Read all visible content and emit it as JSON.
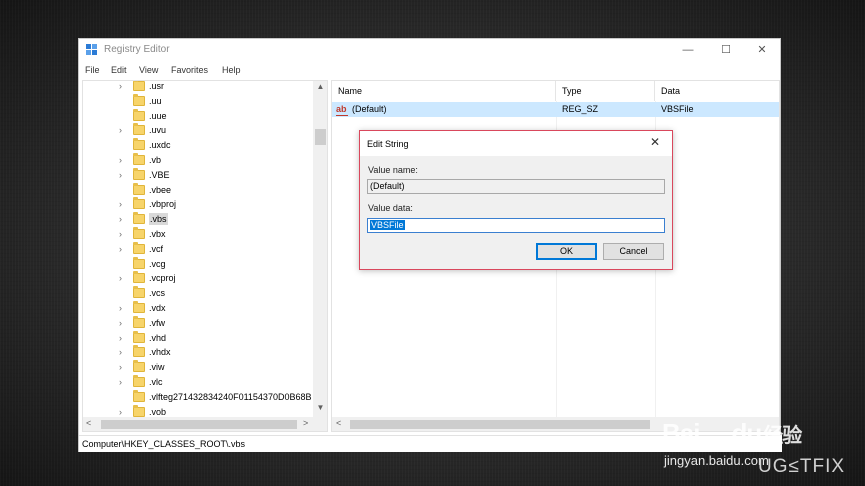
{
  "window": {
    "title": "Registry Editor",
    "controls": {
      "minimize": "—",
      "maximize": "☐",
      "close": "✕"
    }
  },
  "menu": [
    "File",
    "Edit",
    "View",
    "Favorites",
    "Help"
  ],
  "tree": {
    "items": [
      {
        "label": ".usr",
        "expandable": true
      },
      {
        "label": ".uu",
        "expandable": false
      },
      {
        "label": ".uue",
        "expandable": false
      },
      {
        "label": ".uvu",
        "expandable": true
      },
      {
        "label": ".uxdc",
        "expandable": false
      },
      {
        "label": ".vb",
        "expandable": true
      },
      {
        "label": ".VBE",
        "expandable": true
      },
      {
        "label": ".vbee",
        "expandable": false
      },
      {
        "label": ".vbproj",
        "expandable": true
      },
      {
        "label": ".vbs",
        "expandable": true,
        "selected": true
      },
      {
        "label": ".vbx",
        "expandable": true
      },
      {
        "label": ".vcf",
        "expandable": true
      },
      {
        "label": ".vcg",
        "expandable": false
      },
      {
        "label": ".vcproj",
        "expandable": true
      },
      {
        "label": ".vcs",
        "expandable": false
      },
      {
        "label": ".vdx",
        "expandable": true
      },
      {
        "label": ".vfw",
        "expandable": true
      },
      {
        "label": ".vhd",
        "expandable": true
      },
      {
        "label": ".vhdx",
        "expandable": true
      },
      {
        "label": ".viw",
        "expandable": true
      },
      {
        "label": ".vlc",
        "expandable": true
      },
      {
        "label": ".vlfteg271432834240F01154370D0B68B",
        "expandable": false
      },
      {
        "label": ".vob",
        "expandable": true
      }
    ]
  },
  "values": {
    "columns": [
      "Name",
      "Type",
      "Data"
    ],
    "rows": [
      {
        "name": "(Default)",
        "type": "REG_SZ",
        "data": "VBSFile"
      }
    ]
  },
  "status_path": "Computer\\HKEY_CLASSES_ROOT\\.vbs",
  "dialog": {
    "title": "Edit String",
    "value_name_label": "Value name:",
    "value_name": "(Default)",
    "value_data_label": "Value data:",
    "value_data": "VBSFile",
    "ok_label": "OK",
    "cancel_label": "Cancel",
    "close": "✕"
  },
  "watermarks": {
    "baidu": "Bai",
    "baidu_suffix": "经验",
    "du": "du",
    "jingyan": "jingyan.baidu.com",
    "ugetfix": "UG≤TFIX"
  },
  "colors": {
    "selection": "#cce8ff",
    "dialog_border": "#d9475c",
    "text_selection": "#0078d7"
  },
  "icons": {
    "app": "registry-icon",
    "folder": "folder-icon",
    "value": "string-value-icon"
  }
}
